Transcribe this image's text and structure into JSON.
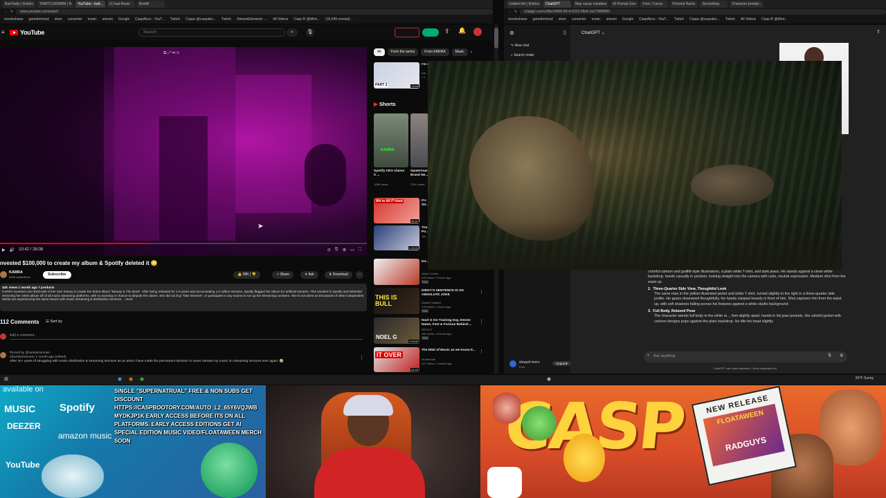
{
  "browser_left": {
    "tabs": [
      "Bad Rally | Roblox",
      "TNMTC1000MIM | N",
      "YouTube - bad...",
      "(1) bad Beats",
      "Reddit",
      "+"
    ],
    "url": "www.youtube.com/watch",
    "bookmarks": [
      "movieshows",
      "gameforlmed",
      "store",
      "converter",
      "music",
      "stream",
      "Google",
      "CaspAboo - YouT...",
      "Twitch",
      "Casps @caspabo...",
      "Twitch",
      "StreamElements -...",
      "All Videos",
      "Casp-R @dfrnt...",
      "(18,649 unread) -"
    ]
  },
  "browser_right": {
    "tabs": [
      "Untitled Art | Roblox",
      "ChatGPT",
      "May cause mistakes",
      "AI Prompt Gen",
      "Free | Canva",
      "Pictorial Hacks",
      "Storytelling",
      "Character prompt..."
    ],
    "url": "chatgpt.com/c/68e18468-50c4-8323-98e8-2e278f98f8f3",
    "bookmarks": [
      "movieshows",
      "gameforlmed",
      "store",
      "converter",
      "music",
      "stream",
      "Google",
      "CaspAboo - YouT...",
      "Twitch",
      "Casps @caspabo...",
      "Twitch",
      "All Videos",
      "Casp-R @dfrnt..."
    ]
  },
  "youtube": {
    "logo": "YouTube",
    "search_placeholder": "Search",
    "time": "10:42 / 26:08",
    "progress": 0.41,
    "title": "nvested $100,000 to create my album & Spotify deleted it 😳",
    "channel": "KARRA",
    "subs": "323K subscribers",
    "subscribe": "Subscribe",
    "likes": "28K",
    "share": "Share",
    "ask": "Ask",
    "download": "Download",
    "desc_meta": "32K views  1 month ago  7 products",
    "description": "KARRA invested over $100,000 of her own money to create her debut album \"Beauty & The Boss\". After being released for 1.5 years and accumulating 1.2 million streams, Spotify flagged her album for artificial streams. This resulted in Spotify and Distrokid removing her entire album off of all music streaming platforms, with no warning or chance to dispute the claims. She did not buy \"fake streams\", or participate in any scams to run up her streaming numbers. She is not alone as thousands of other independent artists are experiencing the same issues with music streaming & distribution services. ...more",
    "comments_count": "112 Comments",
    "sort_by": "Sort by",
    "add_comment": "Add a comment...",
    "pinned": "Pinned by @iamkarramusic",
    "comment_author": "@iamkarramusic  1 month ago (edited)",
    "comment_text": "After 10+ years of struggling with music distribution & streaming services as an artist I have made the permanent decision to never release my music on streaming services ever again. 😭"
  },
  "rail": {
    "chips": [
      "All",
      "From the series",
      "From KARRA",
      "Music"
    ],
    "shorts_label": "Shorts",
    "shorts": [
      {
        "title": "Spotify CEO claims it ...",
        "views": "108K views"
      },
      {
        "title": "Spiderman Brand Ne...",
        "views": "701K views"
      }
    ],
    "videos": [
      {
        "title": "I'm my",
        "channel": "Kar",
        "meta": "7.1",
        "time": "19:53"
      },
      {
        "title": "It's Str...",
        "channel": "",
        "meta": "",
        "time": "40:41"
      },
      {
        "title": "The Po...",
        "channel": "Joe",
        "meta": "",
        "time": "1:29:01"
      },
      {
        "title": "Dir...",
        "channel": "Jody's Corner",
        "meta": "476 views • 3 hours ago",
        "time": "",
        "badge": "New"
      },
      {
        "title": "DIDDY'S SENTENCE IS AN ABSOLUTE JOKE",
        "channel": "Double Toasted",
        "meta": "176 views • 4 hours ago",
        "time": "",
        "badge": "New"
      },
      {
        "title": "Noel G On Training Day, Hector Name, Fast & Furious Behind-...",
        "channel": "REVOLT",
        "meta": "16K views • 6 hours ago",
        "time": "2:33:50",
        "badge": "New"
      },
      {
        "title": "The END of Music as we Know It...",
        "channel": "Al Marshall",
        "meta": "127 views • 1 month ago",
        "time": "24:43"
      }
    ],
    "thumb_texts": [
      "PART 2",
      "KARRA",
      "We're All F*cked",
      "THIS IS BULL",
      "NOEL G",
      "IT OVER"
    ]
  },
  "chatgpt": {
    "model": "ChatGPT",
    "new_chat": "New chat",
    "search_chats": "Search chats",
    "para0": "colorful cartoon and graffiti-style illustrations, a plain white T-shirt, and dark jeans. He stands against a clean white backdrop, hands casually in pockets, looking straight into the camera with calm, neutral expression. Medium shot from the waist up.",
    "item2_title": "Three-Quarter Side View, Thoughtful Look",
    "item2_text": "The same man in the yellow illustrated jacket and white T-shirt, turned slightly to the right in a three-quarter side profile. He gazes downward thoughtfully, his hands clasped loosely in front of him. Shot captures him from the waist up, with soft shadows falling across his features against a white studio background.",
    "item3_title": "Full Body, Relaxed Pose",
    "item3_text": "The character stands full body in the white st..., feet slightly apart, hands in his jean pockets. His colorful jacket with cartoon designs pops against the plain backdrop. He tilts his head slightly",
    "input_placeholder": "Ask anything",
    "footer": "ChatGPT can make mistakes. Check important info.",
    "user": "shaquil rivers",
    "plan": "Free",
    "upgrade": "Upgrade"
  },
  "overlay": {
    "promo": "SINGLE \"SUPERNATRUAL\" FREE & NON SUBS GET DISCOUNT HTTPS://CASPBOOTORY.COM/AUTO_L2_65Y6VQJWB MYDKJP1K EARLY ACCESS BEFORE ITS ON ALL PLATFORMS. EARLY ACCESS EDITIONS GET AI SPECIAL EDITION MUSIC VIDEO/FLOATAWEEN MERCH SOON",
    "platforms": [
      "MUSIC",
      "Spotify",
      "DEEZER",
      "amazon music",
      "YouTube"
    ],
    "available_on": "available on",
    "casp_text": "CASP",
    "new_release": "NEW RELEASE",
    "floataween": "FLOATAWEEN",
    "radguys": "RADGUYS",
    "weather": "82°F Sunny"
  },
  "colors": {
    "yt_red": "#ff0000",
    "casp_orange": "#e96a2a",
    "chat_bg": "#212121"
  }
}
